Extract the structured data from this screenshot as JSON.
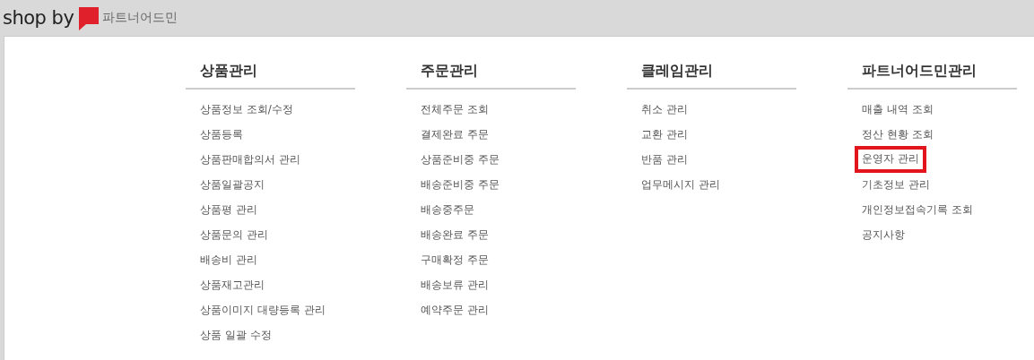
{
  "header": {
    "logo_text": "shop by",
    "subtitle": "파트너어드민"
  },
  "menu": [
    {
      "title": "상품관리",
      "items": [
        {
          "label": "상품정보 조회/수정",
          "highlighted": false
        },
        {
          "label": "상품등록",
          "highlighted": false
        },
        {
          "label": "상품판매합의서 관리",
          "highlighted": false
        },
        {
          "label": "상품일괄공지",
          "highlighted": false
        },
        {
          "label": "상품평 관리",
          "highlighted": false
        },
        {
          "label": "상품문의 관리",
          "highlighted": false
        },
        {
          "label": "배송비 관리",
          "highlighted": false
        },
        {
          "label": "상품재고관리",
          "highlighted": false
        },
        {
          "label": "상품이미지 대량등록 관리",
          "highlighted": false
        },
        {
          "label": "상품 일괄 수정",
          "highlighted": false
        }
      ]
    },
    {
      "title": "주문관리",
      "items": [
        {
          "label": "전체주문 조회",
          "highlighted": false
        },
        {
          "label": "결제완료 주문",
          "highlighted": false
        },
        {
          "label": "상품준비중 주문",
          "highlighted": false
        },
        {
          "label": "배송준비중 주문",
          "highlighted": false
        },
        {
          "label": "배송중주문",
          "highlighted": false
        },
        {
          "label": "배송완료 주문",
          "highlighted": false
        },
        {
          "label": "구매확정 주문",
          "highlighted": false
        },
        {
          "label": "배송보류 관리",
          "highlighted": false
        },
        {
          "label": "예약주문 관리",
          "highlighted": false
        }
      ]
    },
    {
      "title": "클레임관리",
      "items": [
        {
          "label": "취소 관리",
          "highlighted": false
        },
        {
          "label": "교환 관리",
          "highlighted": false
        },
        {
          "label": "반품 관리",
          "highlighted": false
        },
        {
          "label": "업무메시지 관리",
          "highlighted": false
        }
      ]
    },
    {
      "title": "파트너어드민관리",
      "items": [
        {
          "label": "매출 내역 조회",
          "highlighted": false
        },
        {
          "label": "정산 현황 조회",
          "highlighted": false
        },
        {
          "label": "운영자 관리",
          "highlighted": true
        },
        {
          "label": "기초정보 관리",
          "highlighted": false
        },
        {
          "label": "개인정보접속기록 조회",
          "highlighted": false
        },
        {
          "label": "공지사항",
          "highlighted": false
        }
      ]
    }
  ]
}
